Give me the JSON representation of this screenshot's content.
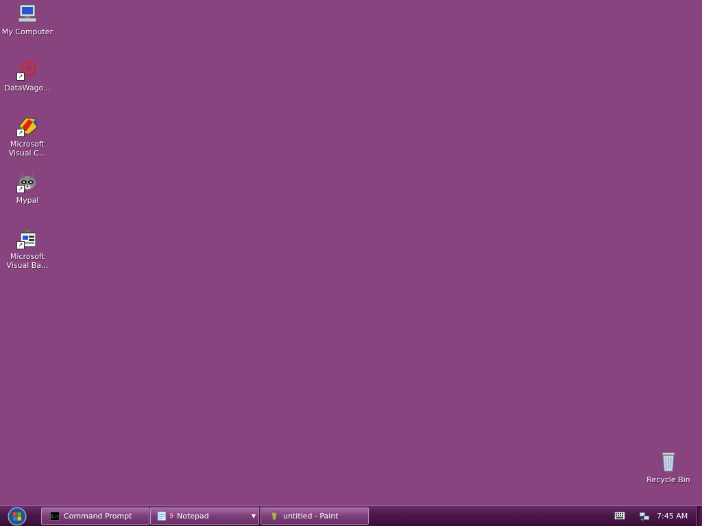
{
  "desktop": {
    "background_color": "#88447f",
    "icons": [
      {
        "label": "My Computer",
        "icon": "computer-icon",
        "shortcut": false
      },
      {
        "label": "DataWago...",
        "icon": "datawagon-icon",
        "shortcut": true
      },
      {
        "label": "Microsoft Visual C...",
        "icon": "visual-c-icon",
        "shortcut": true
      },
      {
        "label": "Mypal",
        "icon": "raccoon-icon",
        "shortcut": true
      },
      {
        "label": "Microsoft Visual Ba...",
        "icon": "visual-basic-icon",
        "shortcut": true
      },
      {
        "label": "Recycle Bin",
        "icon": "recycle-bin-icon",
        "shortcut": false
      }
    ]
  },
  "taskbar": {
    "start": {
      "icon": "windows-logo-icon"
    },
    "buttons": [
      {
        "label": "Command Prompt",
        "icon": "command-prompt-icon"
      },
      {
        "label": "Notepad",
        "icon": "notepad-icon",
        "count": "9",
        "has_dropdown": true
      },
      {
        "label": "untitled - Paint",
        "icon": "paint-icon"
      }
    ],
    "tray": {
      "keyboard_icon": "keyboard-icon",
      "network_icon": "network-icon",
      "clock": "7:45 AM"
    }
  }
}
